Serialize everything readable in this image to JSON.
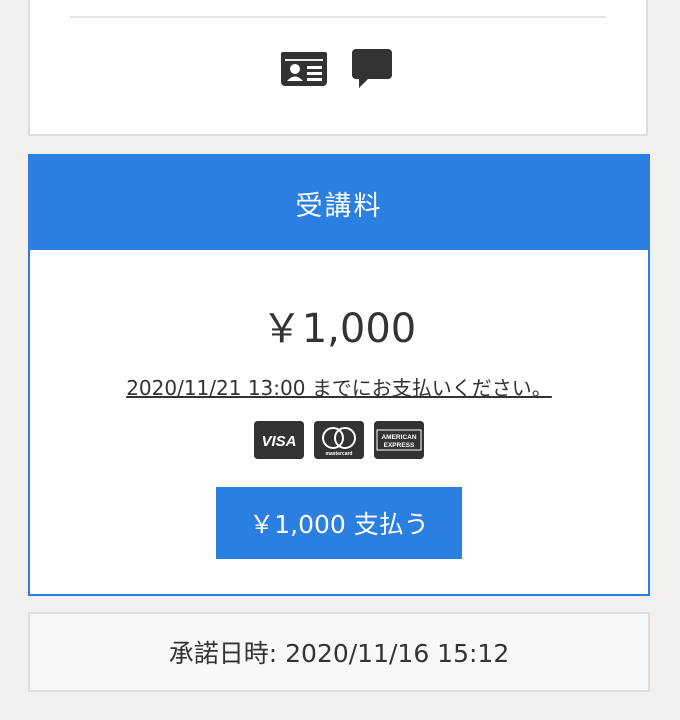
{
  "top_card": {
    "icons": [
      "id-card-icon",
      "chat-bubble-icon"
    ]
  },
  "fee": {
    "title": "受講料",
    "amount": "￥1,000",
    "deadline": "2020/11/21 13:00 までにお支払いください。",
    "payment_brands": [
      {
        "name": "visa-logo",
        "label": "VISA"
      },
      {
        "name": "mastercard-logo",
        "label": "mastercard"
      },
      {
        "name": "amex-logo",
        "label": "AMERICAN EXPRESS"
      }
    ],
    "pay_button": "￥1,000 支払う",
    "colors": {
      "accent": "#2a7fe0"
    }
  },
  "approval": {
    "text": "承諾日時: 2020/11/16 15:12"
  }
}
